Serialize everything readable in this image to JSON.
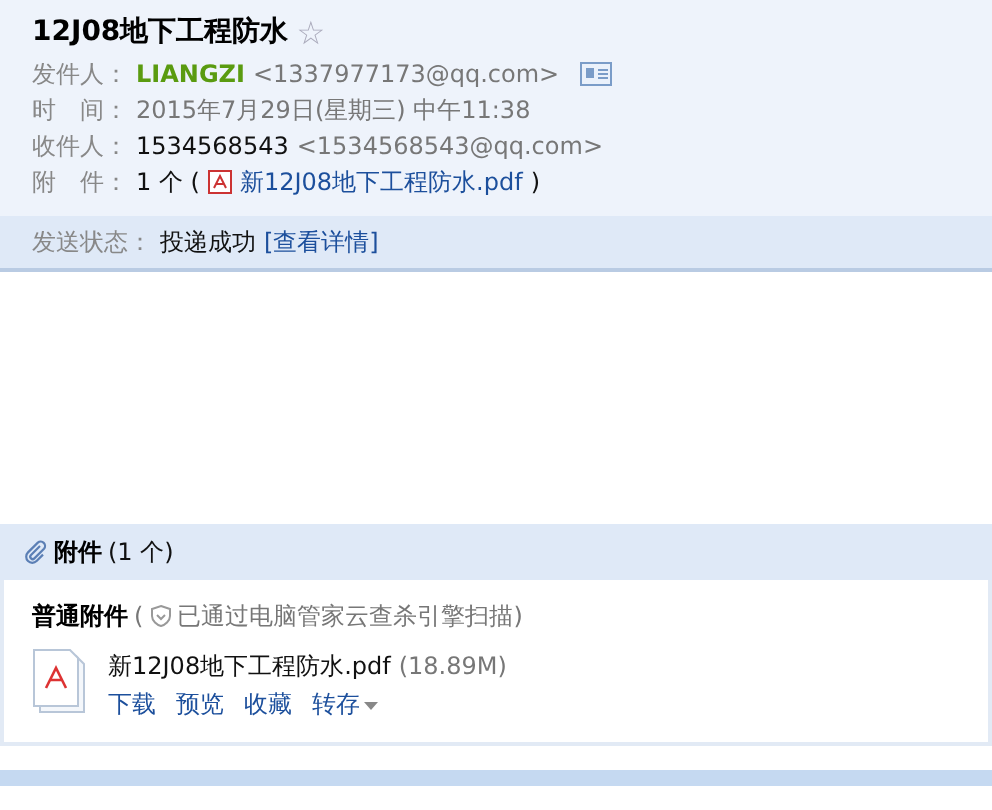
{
  "subject": {
    "title": "12J08地下工程防水",
    "starred": false,
    "star": "☆"
  },
  "fields": [
    {
      "kind": "sender",
      "label": "发件人：",
      "name": "LIANGZI",
      "address": "<1337977173@qq.com>"
    },
    {
      "kind": "plain",
      "label": "时　间：",
      "value": "2015年7月29日(星期三) 中午11:38"
    },
    {
      "kind": "recipient",
      "label": "收件人：",
      "name": "1534568543",
      "address": "<1534568543@qq.com>"
    },
    {
      "kind": "attachment",
      "label": "附　件：",
      "count": "1 个 (",
      "file": "新12J08地下工程防水.pdf",
      "close": ")"
    }
  ],
  "send_status": {
    "label": "发送状态：",
    "value": "投递成功",
    "link": "[查看详情]"
  },
  "attachments": {
    "title": "附件",
    "count": "(1 个)",
    "section": "普通附件",
    "scan_open": "(",
    "scan": "已通过电脑管家云查杀引擎扫描)",
    "files": [
      {
        "name": "新12J08地下工程防水.pdf",
        "size": "(18.89M)",
        "actions": [
          "下载",
          "预览",
          "收藏",
          "转存"
        ]
      }
    ]
  }
}
